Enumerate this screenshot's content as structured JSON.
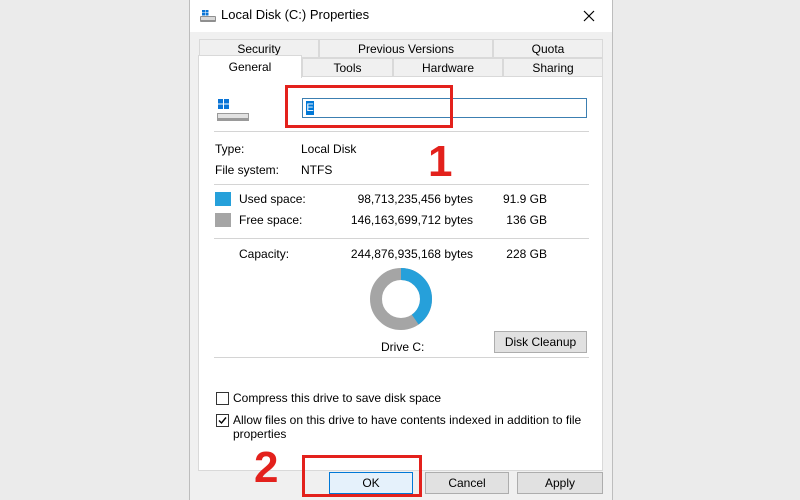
{
  "window": {
    "title": "Local Disk (C:) Properties",
    "icon": "drive-icon",
    "close_icon": "close-icon"
  },
  "tabs": {
    "row_back": [
      "Security",
      "Previous Versions",
      "Quota"
    ],
    "row_front": [
      "General",
      "Tools",
      "Hardware",
      "Sharing"
    ],
    "active": "General"
  },
  "general": {
    "name_value": "",
    "type_label": "Type:",
    "type_value": "Local Disk",
    "fs_label": "File system:",
    "fs_value": "NTFS",
    "used": {
      "label": "Used space:",
      "bytes": "98,713,235,456 bytes",
      "size": "91.9 GB",
      "color": "#26a0da"
    },
    "free": {
      "label": "Free space:",
      "bytes": "146,163,699,712 bytes",
      "size": "136 GB",
      "color": "#a5a5a5"
    },
    "capacity": {
      "label": "Capacity:",
      "bytes": "244,876,935,168 bytes",
      "size": "228 GB"
    },
    "used_fraction": 0.403,
    "drive_label": "Drive C:",
    "disk_cleanup_label": "Disk Cleanup",
    "compress": {
      "label": "Compress this drive to save disk space",
      "checked": false
    },
    "index": {
      "label_line1": "Allow files on this drive to have contents indexed in addition to file",
      "label_line2": "properties",
      "checked": true
    }
  },
  "buttons": {
    "ok": "OK",
    "cancel": "Cancel",
    "apply": "Apply"
  },
  "annotations": {
    "one": "1",
    "two": "2",
    "color": "#e3211c"
  }
}
